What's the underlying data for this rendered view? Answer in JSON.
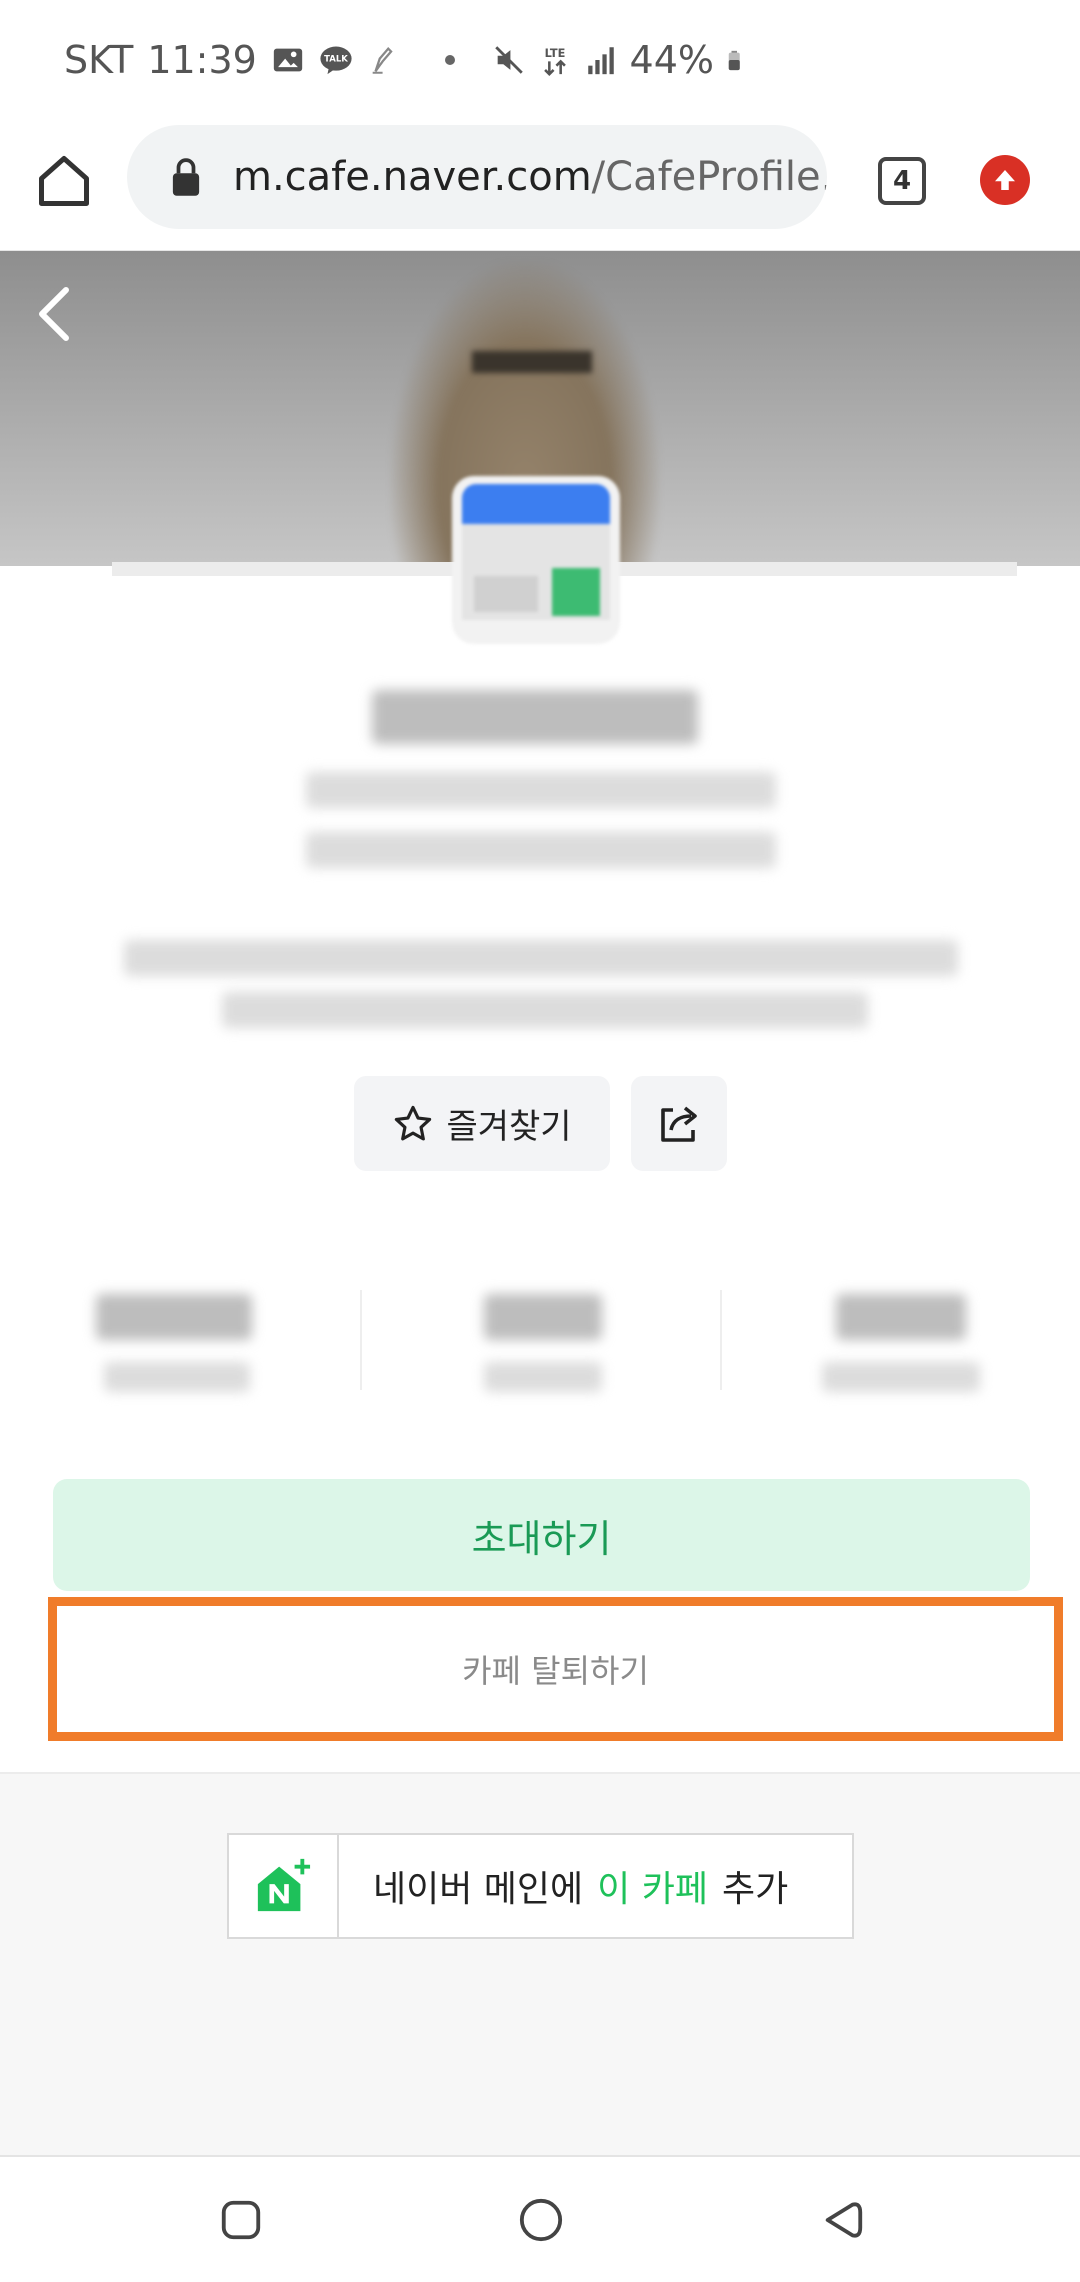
{
  "status_bar": {
    "carrier": "SKT",
    "time": "11:39",
    "network": "LTE",
    "battery": "44%"
  },
  "browser": {
    "url_host": "m.cafe.naver.com",
    "url_path": "/CafeProfile.",
    "tab_count": "4"
  },
  "profile": {
    "favorite_label": "즐겨찾기"
  },
  "actions": {
    "invite_label": "초대하기",
    "leave_label": "카페 탈퇴하기"
  },
  "footer": {
    "add_main_prefix": "네이버 메인에",
    "add_main_highlight": "이 카페",
    "add_main_suffix": "추가"
  },
  "colors": {
    "invite_bg": "#dcf6e8",
    "invite_text": "#1a9a55",
    "highlight_border": "#f07c2a",
    "naver_green": "#1ec15a"
  }
}
